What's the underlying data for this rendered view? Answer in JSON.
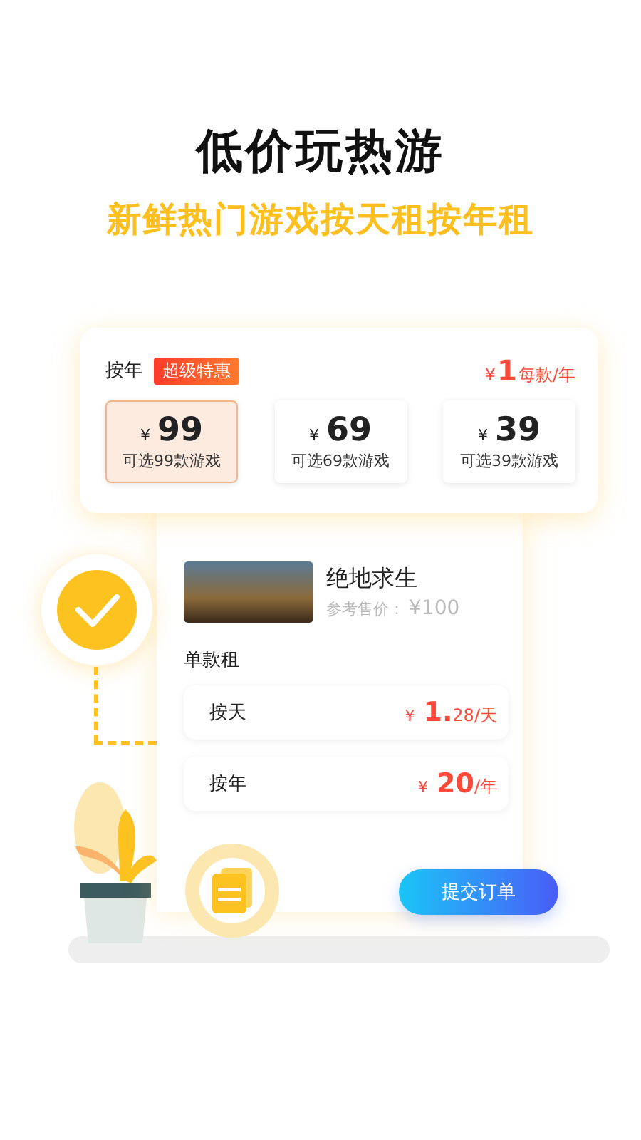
{
  "headline": "低价玩热游",
  "subheadline": "新鲜热门游戏按天租按年租",
  "annual_plan": {
    "title": "按年",
    "badge": "超级特惠",
    "price": {
      "currency": "¥",
      "amount": "1",
      "unit": "每款/年"
    },
    "tiers": [
      {
        "currency": "¥",
        "amount": "99",
        "caption": "可选99款游戏",
        "selected": true
      },
      {
        "currency": "¥",
        "amount": "69",
        "caption": "可选69款游戏",
        "selected": false
      },
      {
        "currency": "¥",
        "amount": "39",
        "caption": "可选39款游戏",
        "selected": false
      }
    ]
  },
  "game": {
    "name": "绝地求生",
    "reference_label": "参考售价：",
    "reference_price": "¥100"
  },
  "single_rental": {
    "title": "单款租",
    "options": [
      {
        "label": "按天",
        "currency": "¥",
        "amount": "1.",
        "decimals": "28",
        "unit": "/天"
      },
      {
        "label": "按年",
        "currency": "¥",
        "amount": "20",
        "unit": "/年"
      }
    ]
  },
  "submit_button": "提交订单"
}
